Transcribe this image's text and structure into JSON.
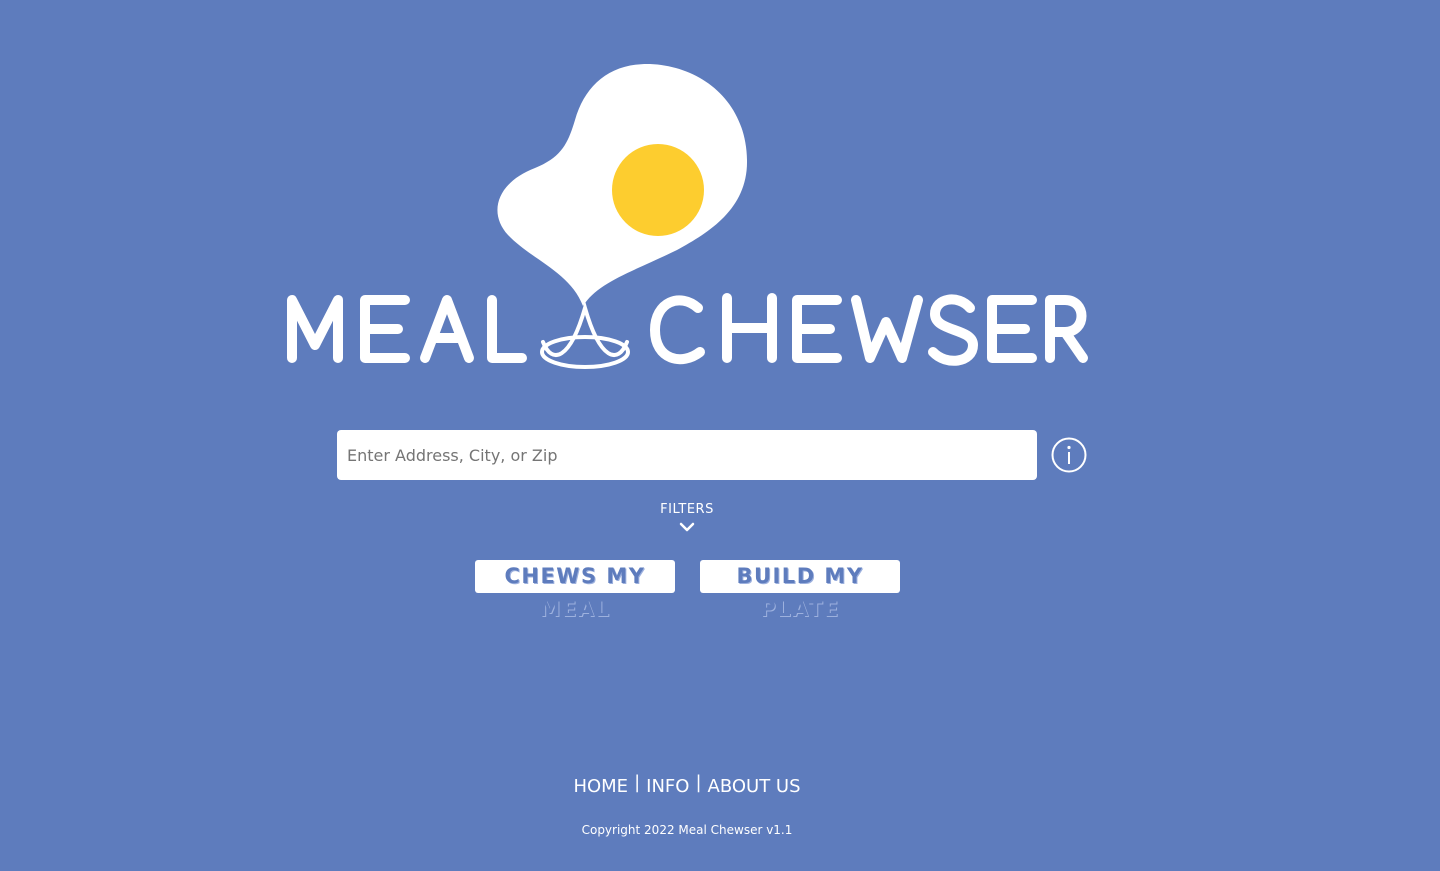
{
  "brand": {
    "name": "Meal Chewser",
    "logo_word_left": "MEAL",
    "logo_word_right": "CHEWSER",
    "colors": {
      "background": "#5e7cbd",
      "egg_white": "#ffffff",
      "yolk": "#fdcd2f"
    }
  },
  "search": {
    "placeholder": "Enter Address, City, or Zip",
    "value": "",
    "info_icon": "info-circle-icon"
  },
  "filters": {
    "label": "FILTERS",
    "icon": "chevron-down-icon"
  },
  "actions": {
    "chews_label": "CHEWS MY MEAL",
    "build_label": "BUILD MY PLATE"
  },
  "footer": {
    "nav": [
      {
        "label": "HOME"
      },
      {
        "label": "INFO"
      },
      {
        "label": "ABOUT US"
      }
    ],
    "separator": "|",
    "copyright": "Copyright 2022 Meal Chewser v1.1"
  }
}
